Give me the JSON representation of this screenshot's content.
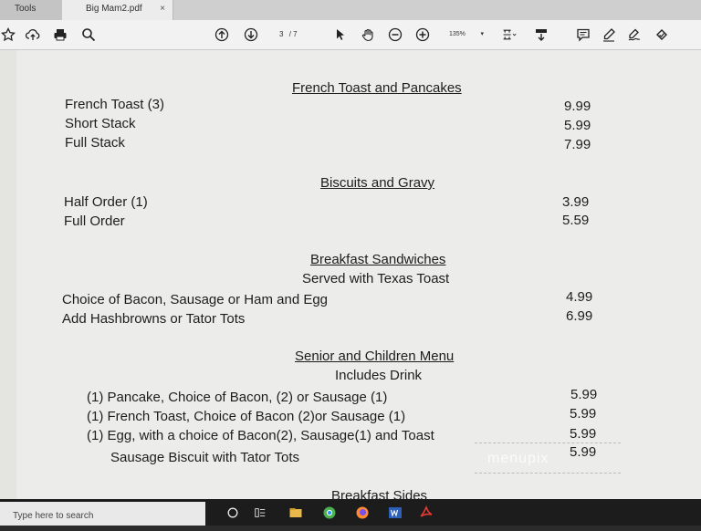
{
  "tabs": {
    "tools_label": "Tools",
    "doc_label": "Big Mam2.pdf",
    "close_glyph": "×"
  },
  "toolbar": {
    "page_current": "3",
    "page_total": "/ 7",
    "zoom": "135%",
    "zoom_caret": "▾"
  },
  "menu": {
    "sections": [
      {
        "heading": "French Toast and Pancakes",
        "items": [
          {
            "name": "French Toast (3)",
            "price": "9.99"
          },
          {
            "name": "Short Stack",
            "price": "5.99"
          },
          {
            "name": "Full Stack",
            "price": "7.99"
          }
        ]
      },
      {
        "heading": "Biscuits and Gravy",
        "items": [
          {
            "name": "Half Order (1)",
            "price": "3.99"
          },
          {
            "name": "Full Order",
            "price": "5.59"
          }
        ]
      },
      {
        "heading": "Breakfast Sandwiches",
        "subheading": "Served with Texas Toast",
        "items": [
          {
            "name": "Choice of Bacon, Sausage or Ham and Egg",
            "price": "4.99"
          },
          {
            "name": "Add Hashbrowns or Tator Tots",
            "price": "6.99"
          }
        ]
      },
      {
        "heading": "Senior and Children Menu",
        "subheading": "Includes Drink",
        "items": [
          {
            "name": "(1)  Pancake, Choice of Bacon, (2) or Sausage (1)",
            "price": "5.99"
          },
          {
            "name": "(1)  French Toast, Choice of Bacon (2)or Sausage (1)",
            "price": "5.99"
          },
          {
            "name": "(1)  Egg, with a choice of Bacon(2), Sausage(1) and Toast",
            "price": "5.99"
          },
          {
            "name": "Sausage Biscuit with Tator Tots",
            "price": "5.99"
          }
        ]
      },
      {
        "heading": "Breakfast Sides"
      }
    ]
  },
  "watermark": "menupix",
  "taskbar": {
    "search_placeholder": "Type here to search"
  }
}
